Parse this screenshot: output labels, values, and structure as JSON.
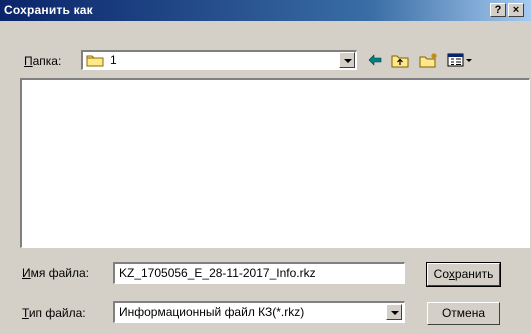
{
  "dialog": {
    "title": "Сохранить как"
  },
  "titlebar": {
    "help_label": "?",
    "close_label": "×"
  },
  "folder": {
    "label": "Папка:",
    "value": "1"
  },
  "filename": {
    "label": "Имя файла:",
    "value": "KZ_1705056_E_28-11-2017_Info.rkz"
  },
  "filetype": {
    "label": "Тип файла:",
    "value": "Информационный файл КЗ(*.rkz)"
  },
  "buttons": {
    "save": "Сохранить",
    "cancel": "Отмена"
  },
  "toolbar": {
    "icons": [
      "back-arrow-icon",
      "up-folder-icon",
      "new-folder-icon",
      "view-menu-icon"
    ],
    "accent": "#008080"
  },
  "colors": {
    "title_bar": "#0a246a",
    "dialog_bg": "#d4d0c8"
  }
}
